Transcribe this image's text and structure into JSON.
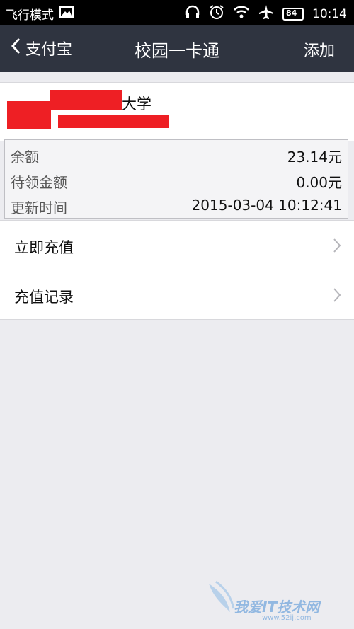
{
  "status_bar": {
    "mode_text": "飞行模式",
    "battery": "84",
    "time": "10:14",
    "icons": [
      "image-icon",
      "headphones-icon",
      "alarm-icon",
      "wifi-icon",
      "airplane-icon",
      "battery-icon"
    ]
  },
  "navbar": {
    "back_label": "支付宝",
    "title": "校园一卡通",
    "add_label": "添加"
  },
  "card": {
    "school_suffix": "大学",
    "redaction_color": "#ee1f24"
  },
  "info": [
    {
      "label": "余额",
      "value": "23.14元"
    },
    {
      "label": "待领金额",
      "value": "0.00元"
    },
    {
      "label": "更新时间",
      "value": "2015-03-04 10:12:41"
    }
  ],
  "menu": [
    {
      "label": "立即充值"
    },
    {
      "label": "充值记录"
    }
  ],
  "watermark": {
    "text": "我爱IT技术网",
    "sub": "www.52ij.com"
  },
  "colors": {
    "navbar_bg": "#2f3440",
    "page_bg": "#ececf0"
  }
}
